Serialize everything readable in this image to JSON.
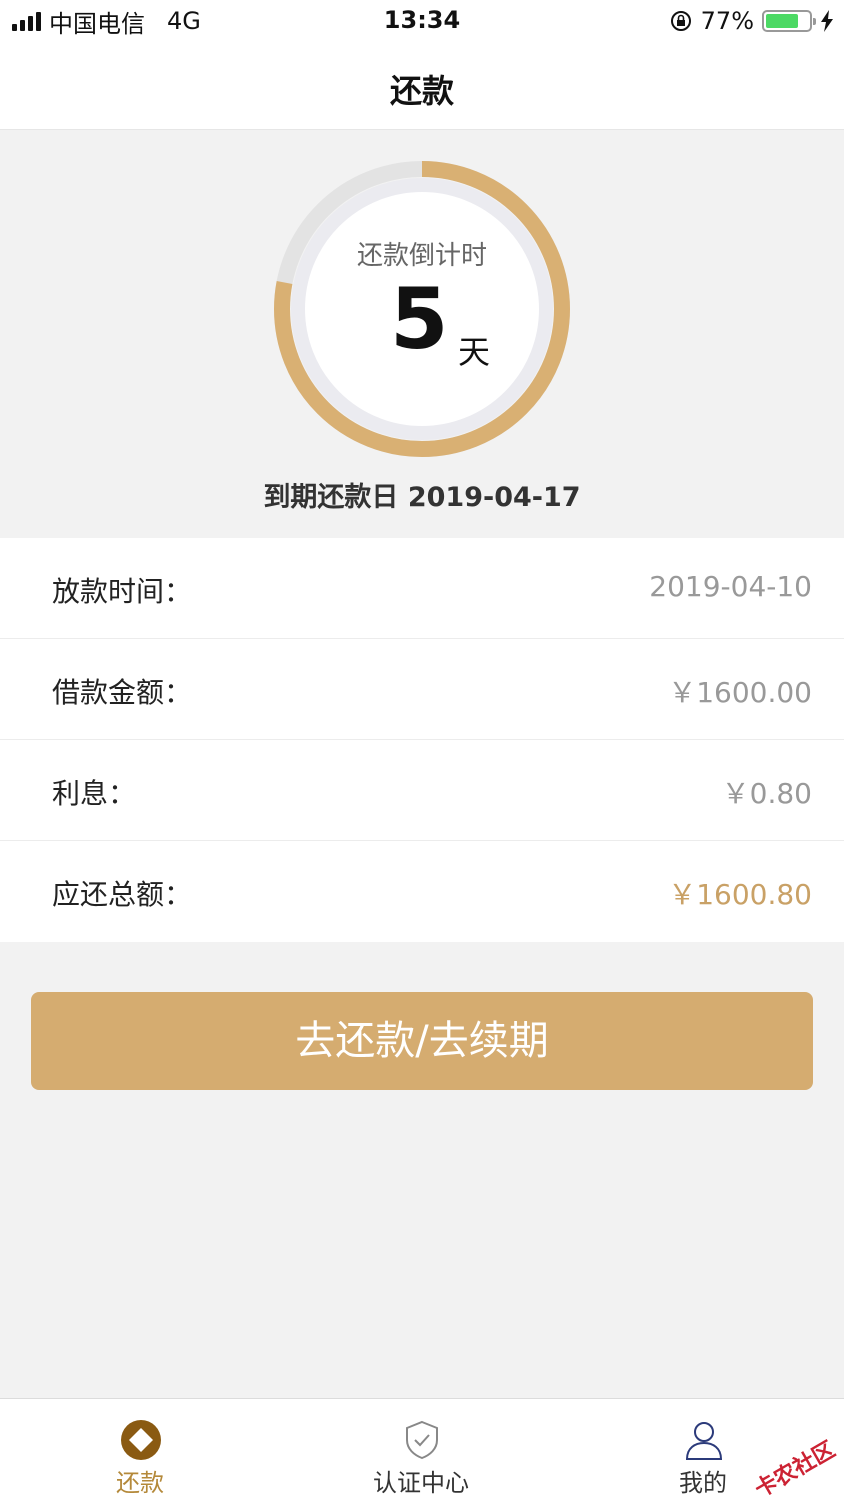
{
  "status_bar": {
    "carrier": "中国电信",
    "network": "4G",
    "time": "13:34",
    "battery_percent": "77%",
    "battery_level": 0.77,
    "icons": [
      "signal-icon",
      "rotation-lock-icon",
      "battery-icon",
      "charging-icon"
    ]
  },
  "nav": {
    "title": "还款"
  },
  "countdown": {
    "label": "还款倒计时",
    "days": "5",
    "unit": "天",
    "progress": 0.78,
    "due_date_label": "到期还款日 2019-04-17",
    "colors": {
      "progress": "#d9b073",
      "track": "#e3e3e3",
      "inner_ring": "#ebebf0"
    }
  },
  "info": {
    "rows": [
      {
        "label": "放款时间：",
        "value": "2019-04-10"
      },
      {
        "label": "借款金额：",
        "value": "￥1600.00"
      },
      {
        "label": "利息：",
        "value": "￥0.80"
      },
      {
        "label": "应还总额：",
        "value": "￥1600.80"
      }
    ]
  },
  "action": {
    "button_label": "去还款/去续期"
  },
  "tabs": [
    {
      "label": "还款",
      "icon": "repay-icon",
      "active": true
    },
    {
      "label": "认证中心",
      "icon": "shield-check-icon",
      "active": false
    },
    {
      "label": "我的",
      "icon": "user-icon",
      "active": false
    }
  ],
  "watermark": "卡农社区",
  "colors": {
    "accent": "#d5ac70",
    "accent_text": "#b4893a",
    "page_bg": "#f2f2f2"
  }
}
